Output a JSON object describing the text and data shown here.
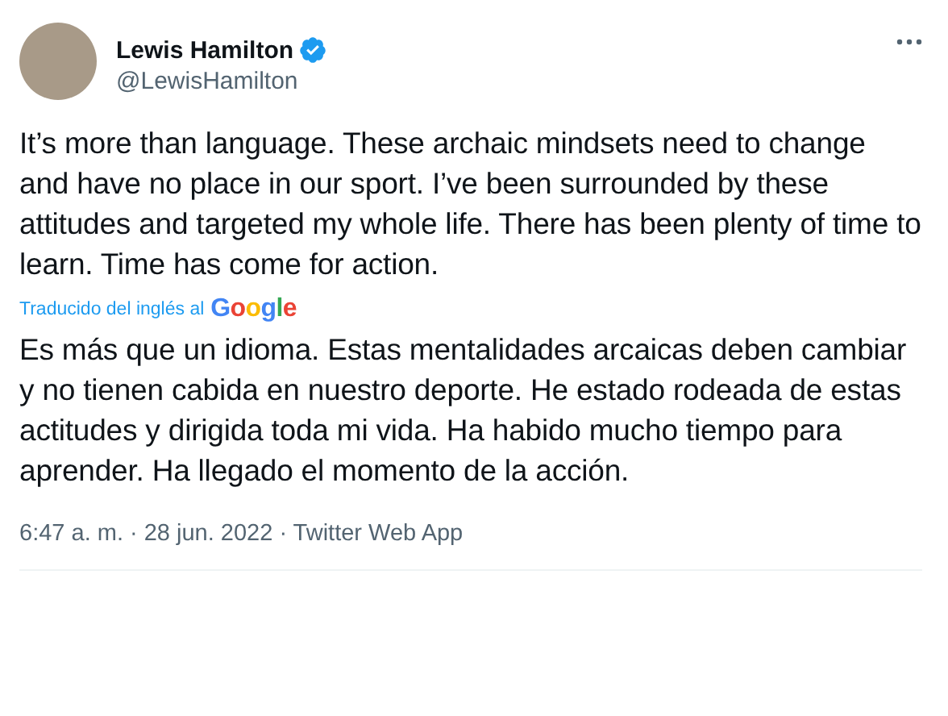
{
  "author": {
    "name": "Lewis Hamilton",
    "verified": true,
    "handle": "@LewisHamilton"
  },
  "tweet_text": "It’s more than language. These archaic mindsets need to change and have no place in our sport. I’ve been surrounded by these attitudes and targeted my whole life. There has been plenty of time to learn. Time has come for action.",
  "translation": {
    "label": "Traducido del inglés al",
    "provider_logo": "Google",
    "text": "Es más que un idioma. Estas mentalidades arcaicas deben cambiar y no tienen cabida en nuestro deporte. He estado rodeada de estas actitudes y dirigida toda mi vida. Ha habido mucho tiempo para aprender. Ha llegado el momento de la acción."
  },
  "timestamp": "6:47 a. m. · 28 jun. 2022 · Twitter Web App"
}
